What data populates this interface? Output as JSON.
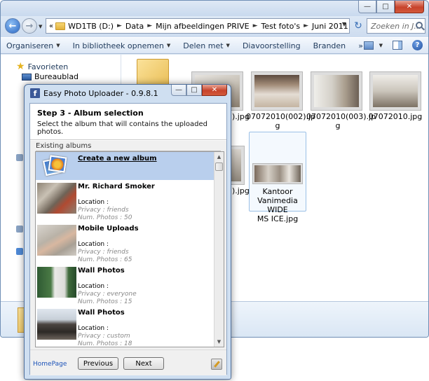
{
  "explorer": {
    "breadcrumbs": [
      "WD1TB (D:)",
      "Data",
      "Mijn afbeeldingen PRIVE",
      "Test foto's",
      "Juni 2011"
    ],
    "search_placeholder": "Zoeken in J...",
    "toolbar": [
      {
        "label": "Organiseren",
        "dropdown": true
      },
      {
        "label": "In bibliotheek opnemen",
        "dropdown": true
      },
      {
        "label": "Delen met",
        "dropdown": true
      },
      {
        "label": "Diavoorstelling",
        "dropdown": false
      },
      {
        "label": "Branden",
        "dropdown": false
      },
      {
        "label": "»",
        "dropdown": false
      }
    ],
    "nav": {
      "favorites": "Favorieten",
      "desktop": "Bureaublad"
    },
    "files": {
      "partial_1": ").jpg",
      "f1_line1": "07072010(002).jp",
      "f1_line2": "g",
      "f2_line1": "07072010(003).jp",
      "f2_line2": "g",
      "f3": "07072010.jpg",
      "partial_2": ").jpg",
      "selected_line1": "Kantoor",
      "selected_line2": "Vanimedia WIDE",
      "selected_line3": "MS ICE.jpg"
    }
  },
  "dialog": {
    "title": "Easy Photo Uploader - 0.9.8.1",
    "step_title": "Step 3 - Album selection",
    "step_desc": "Select the album that will contains the uploaded photos.",
    "group_label": "Existing albums",
    "albums": [
      {
        "name": "Create a new album"
      },
      {
        "name": "Mr. Richard Smoker",
        "location": "Location :",
        "privacy": "Privacy : friends",
        "num": "Num. Photos : 50"
      },
      {
        "name": "Mobile Uploads",
        "location": "Location :",
        "privacy": "Privacy : friends",
        "num": "Num. Photos : 65"
      },
      {
        "name": "Wall Photos",
        "location": "Location :",
        "privacy": "Privacy : everyone",
        "num": "Num. Photos : 15"
      },
      {
        "name": "Wall Photos",
        "location": "Location :",
        "privacy": "Privacy : custom",
        "num": "Num. Photos : 18"
      }
    ],
    "homepage": "HomePage",
    "previous": "Previous",
    "next": "Next"
  }
}
